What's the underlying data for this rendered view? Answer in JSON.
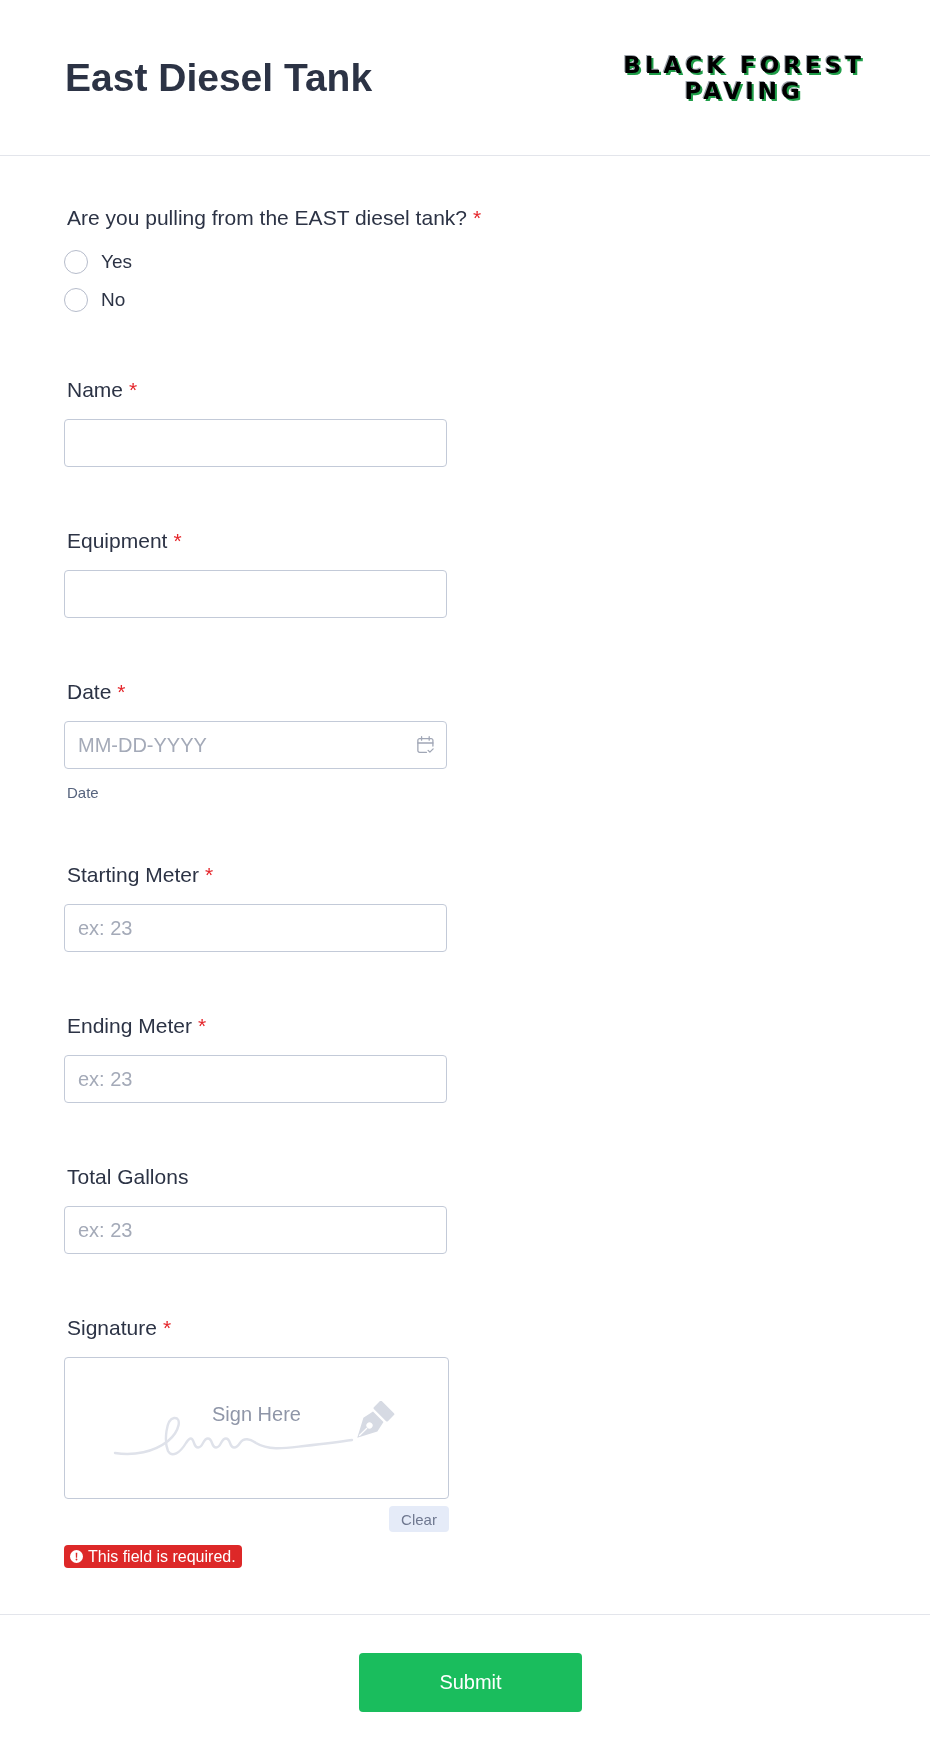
{
  "header": {
    "title": "East Diesel Tank",
    "logo": {
      "lines": [
        "BLACK FOREST",
        "PAVING"
      ]
    }
  },
  "fields": [
    {
      "kind": "radio",
      "label": "Are you pulling from the EAST diesel tank?",
      "required_mark": "*",
      "options": [
        {
          "label": "Yes",
          "selected": false
        },
        {
          "label": "No",
          "selected": false
        }
      ]
    },
    {
      "kind": "text",
      "label": "Name",
      "required_mark": "*"
    },
    {
      "kind": "text",
      "label": "Equipment",
      "required_mark": "*"
    },
    {
      "kind": "date",
      "label": "Date",
      "required_mark": "*",
      "placeholder": "MM-DD-YYYY",
      "sublabel": "Date"
    },
    {
      "kind": "text",
      "label": "Starting Meter",
      "required_mark": "*",
      "placeholder": "ex: 23"
    },
    {
      "kind": "text",
      "label": "Ending Meter",
      "required_mark": "*",
      "placeholder": "ex: 23"
    },
    {
      "kind": "text",
      "label": "Total Gallons",
      "placeholder": "ex: 23"
    },
    {
      "kind": "signature",
      "label": "Signature",
      "required_mark": "*",
      "prompt": "Sign Here",
      "clear_button": "Clear",
      "error": "This field is required."
    }
  ],
  "submit_button": "Submit"
}
